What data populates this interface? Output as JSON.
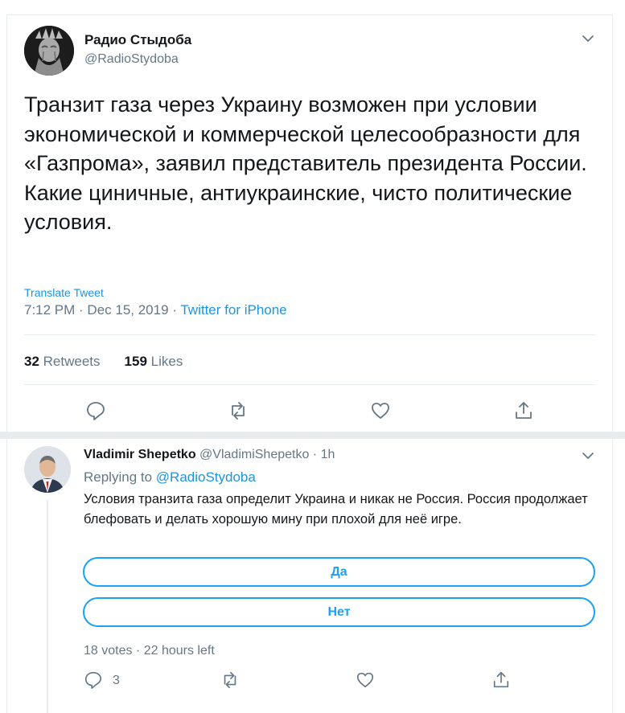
{
  "tweet": {
    "author_name": "Радио Стыдоба",
    "author_handle": "@RadioStydoba",
    "text_lines": [
      "Транзит газа через Украину возможен при условии экономической и коммерческой целесообразности для «Газпрома», заявил представитель президента России.",
      "Какие циничные, антиукраинские, чисто политические условия."
    ],
    "translate_label": "Translate Tweet",
    "timestamp": "7:12 PM · Dec 15, 2019 · ",
    "source": "Twitter for iPhone",
    "retweets_count": "32",
    "retweets_label": "Retweets",
    "likes_count": "159",
    "likes_label": "Likes"
  },
  "reply": {
    "author_name": "Vladimir Shepetko",
    "author_handle": "@VladimiShepetko",
    "time": " · 1h",
    "replying_prefix": "Replying to ",
    "replying_to": "@RadioStydoba",
    "text": "Условия транзита газа определит Украина и никак не Россия. Россия продолжает блефовать и делать хорошую мину при плохой для неё игре.",
    "poll_options": [
      "Да",
      "Нет"
    ],
    "poll_summary": "18 votes · 22 hours left",
    "reply_count": "3"
  },
  "colors": {
    "accent": "#1da1f2",
    "link": "#1b95e0",
    "secondary_text": "#657786",
    "divider": "#e6ecf0"
  },
  "icons": [
    "chevron-down-icon",
    "reply-icon",
    "retweet-icon",
    "like-icon",
    "share-icon"
  ]
}
